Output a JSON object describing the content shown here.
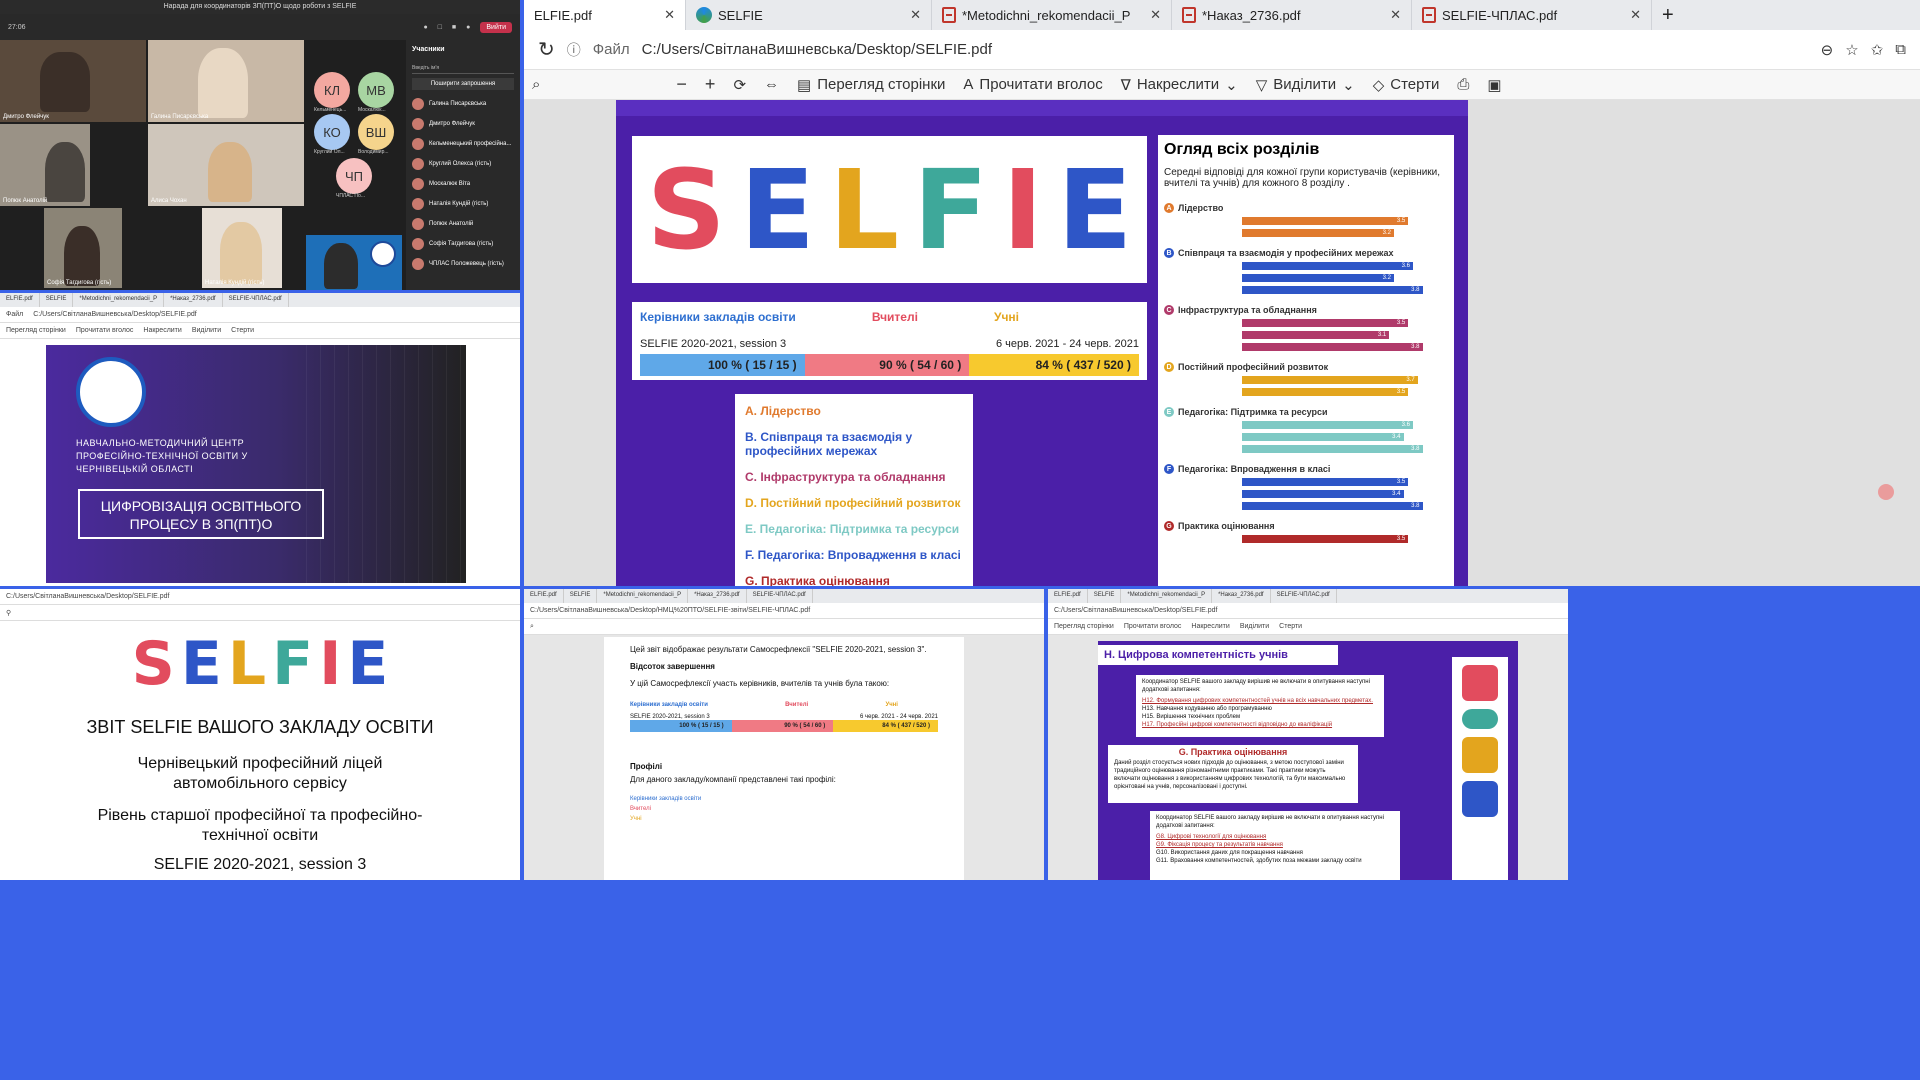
{
  "main_browser": {
    "tabs": [
      {
        "label": "ELFIE.pdf",
        "icon": "pdf-icon",
        "active": true
      },
      {
        "label": "SELFIE",
        "icon": "edge-icon",
        "active": false
      },
      {
        "label": "*Metodichni_rekomendacii_P",
        "icon": "pdf-icon",
        "active": false
      },
      {
        "label": "*Наказ_2736.pdf",
        "icon": "pdf-icon",
        "active": false
      },
      {
        "label": "SELFIE-ЧПЛАС.pdf",
        "icon": "pdf-icon",
        "active": false
      }
    ],
    "address_prefix": "Файл",
    "address_url": "C:/Users/СвітланаВишневська/Desktop/SELFIE.pdf",
    "toolbar": {
      "page_view": "Перегляд сторінки",
      "read_aloud": "Прочитати вголос",
      "draw": "Накреслити",
      "highlight": "Виділити",
      "erase": "Стерти"
    }
  },
  "selfie_doc": {
    "respondent_groups": [
      "Керівники закладів освіти",
      "Вчителі",
      "Учні"
    ],
    "session": "SELFIE 2020-2021, session 3",
    "dates": "6 черв. 2021 - 24 черв. 2021",
    "participation": [
      "100 % ( 15 / 15 )",
      "90 % ( 54 / 60 )",
      "84 % ( 437 / 520 )"
    ],
    "sections": [
      {
        "label": "A. Лідерство",
        "color": "#e07a2e"
      },
      {
        "label": "B. Співпраця та взаємодія у професійних мережах",
        "color": "#2e56c7"
      },
      {
        "label": "C. Інфраструктура та обладнання",
        "color": "#b03a6a"
      },
      {
        "label": "D. Постійний професійний розвиток",
        "color": "#e3a51e"
      },
      {
        "label": "E. Педагогіка: Підтримка та ресурси",
        "color": "#7ec9c4"
      },
      {
        "label": "F. Педагогіка: Впровадження в класі",
        "color": "#2e56c7"
      },
      {
        "label": "G. Практика оцінювання",
        "color": "#b02a2a"
      }
    ],
    "overview_title": "Огляд всіх розділів",
    "overview_subtitle": "Середні відповіді для кожної групи користувачів (керівники, вчителі та учнів) для кожного 8 розділу .",
    "overview_groups": [
      {
        "letter": "A",
        "name": "Лідерство",
        "color": "#e07a2e",
        "values": [
          "3.5",
          "3.2"
        ]
      },
      {
        "letter": "B",
        "name": "Співпраця та взаємодія у професійних мережах",
        "color": "#2e56c7",
        "values": [
          "3.6",
          "3.2",
          "3.8"
        ]
      },
      {
        "letter": "C",
        "name": "Інфраструктура та обладнання",
        "color": "#b03a6a",
        "values": [
          "3.5",
          "3.1",
          "3.8"
        ]
      },
      {
        "letter": "D",
        "name": "Постійний професійний розвиток",
        "color": "#e3a51e",
        "values": [
          "3.7",
          "3.5"
        ]
      },
      {
        "letter": "E",
        "name": "Педагогіка: Підтримка та ресурси",
        "color": "#7ec9c4",
        "values": [
          "3.6",
          "3.4",
          "3.8"
        ]
      },
      {
        "letter": "F",
        "name": "Педагогіка: Впровадження в класі",
        "color": "#2e56c7",
        "values": [
          "3.5",
          "3.4",
          "3.8"
        ]
      },
      {
        "letter": "G",
        "name": "Практика оцінювання",
        "color": "#b02a2a",
        "values": [
          "3.5"
        ]
      }
    ],
    "selfie_word": "SELFIE"
  },
  "meeting": {
    "title": "Нарада для координаторів ЗП(ПТ)О щодо роботи з SELFIE",
    "timer": "27:06",
    "leave_button": "Вийти",
    "participants_title": "Учасники",
    "invite_placeholder": "Введіть ім'я",
    "share_invite": "Поширити запрошення",
    "avatars": [
      {
        "initials": "КЛ",
        "name": "Кельменець...",
        "color": "#f3a8a0"
      },
      {
        "initials": "МВ",
        "name": "Москалюк...",
        "color": "#a8d5a2"
      },
      {
        "initials": "КО",
        "name": "Круглий Ол...",
        "color": "#a7c8f2"
      },
      {
        "initials": "ВШ",
        "name": "Володимир...",
        "color": "#f5d48c"
      },
      {
        "initials": "ЧП",
        "name": "ЧПЛАС По...",
        "color": "#f7c1c1"
      }
    ],
    "participants": [
      "Галина Писарєвська",
      "Дмитро Флейчук",
      "Кельменецький професійна...",
      "Круглий Олекса (гість)",
      "Москалюк Віта",
      "Наталія Кундій (гість)",
      "Попюк Анатолій",
      "Софія Тагдигова (гість)",
      "ЧПЛАС Положевець (гість)"
    ],
    "video_names": [
      "Дмитро Флейчук",
      "Галина Писарєвська",
      "Попюк Анатолій",
      "Алиса Чохан",
      "Софія Тагдигова (гість)",
      "Наталія Кундій (гість)"
    ]
  },
  "presentation": {
    "org": "НАВЧАЛЬНО-МЕТОДИЧНИЙ ЦЕНТР ПРОФЕСІЙНО-ТЕХНІЧНОЇ ОСВІТИ У ЧЕРНІВЕЦЬКІЙ ОБЛАСТІ",
    "title": "ЦИФРОВІЗАЦІЯ ОСВІТНЬОГО ПРОЦЕСУ В ЗП(ПТ)О"
  },
  "report": {
    "heading": "ЗВІТ SELFIE ВАШОГО ЗАКЛАДУ ОСВІТИ",
    "school": "Чернівецький професійний ліцей автомобільного сервісу",
    "level": "Рівень старшої професійної та професійно-технічної освіти",
    "session": "SELFIE 2020-2021, session 3"
  },
  "completion_doc": {
    "address": "C:/Users/СвітланаВишневська/Desktop/НМЦ%20ПТО/SELFIE-звіти/SELFIE-ЧПЛАС.pdf",
    "intro": "Цей звіт відображає результати Самосрефлексії \"SELFIE 2020-2021, session 3\".",
    "completion_heading": "Відсоток завершення",
    "completion_text": "У цій Самосрефлексії участь керівників, вчителів та учнів була такою:",
    "profiles_heading": "Профілі",
    "profiles_text": "Для даного закладу/компанії представлені такі профілі:"
  },
  "digital_doc": {
    "section_h": "H. Цифрова компетентність учнів",
    "coordinator_text": "Координатор SELFIE вашого закладу вирішив не включати в опитування наступні додаткові запитання:",
    "h_items": [
      "H12. Формування цифрових компетентностей учнів на всіх навчальних предметах.",
      "H13. Навчання кодуванню або програмуванню",
      "H15. Вирішення технічних проблем",
      "H17. Професійні цифрові компетентності відповідно до кваліфікацій"
    ],
    "section_g": "G. Практика оцінювання",
    "g_text": "Даний розділ стосується нових підходів до оцінювання, з метою поступової заміни традиційного оцінювання різноманітними практиками. Такі практики можуть включати оцінювання з використанням цифрових технологій, та бути максимально орієнтовані на учнів, персоналізовані і доступні.",
    "g_items": [
      "G8. Цифрові технології для оцінювання",
      "G9. Фіксація процесу та результатів навчання",
      "G10. Використання даних для покращення навчання",
      "G11. Враховання компетентностей, здобутих поза межами закладу освіти"
    ]
  }
}
